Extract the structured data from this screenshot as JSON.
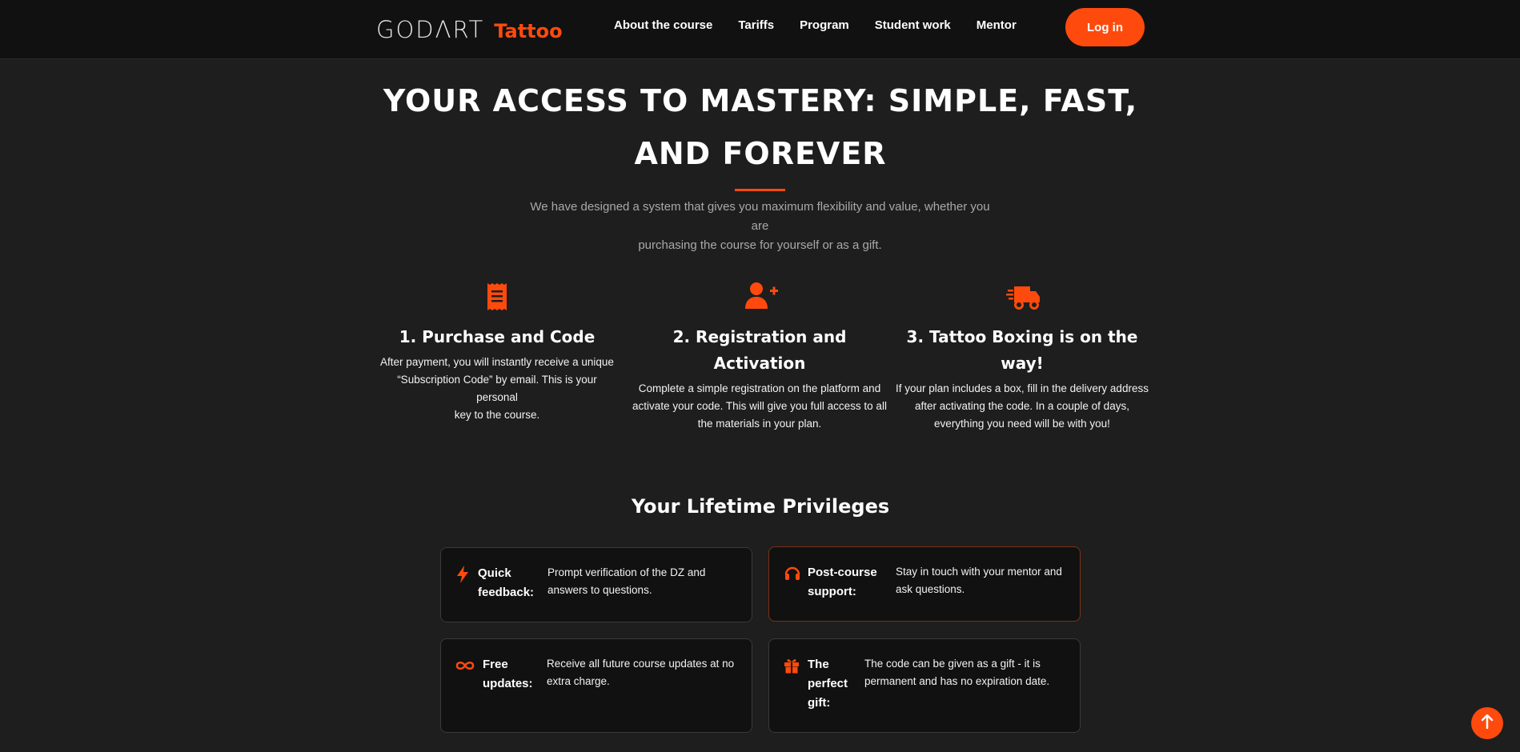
{
  "header": {
    "logo_main": "GODΛRT",
    "logo_sub": "Tattoo",
    "nav": [
      "About the course",
      "Tariffs",
      "Program",
      "Student work",
      "Mentor"
    ],
    "login": "Log in"
  },
  "hero": {
    "title_line1": "YOUR ACCESS TO MASTERY: SIMPLE, FAST,",
    "title_line2": "AND FOREVER",
    "subtitle_line1": "We have designed a system that gives you maximum flexibility and value, whether you are",
    "subtitle_line2": "purchasing the course for yourself or as a gift."
  },
  "steps": [
    {
      "icon": "receipt-icon",
      "title": "1. Purchase and Code",
      "text": [
        "After payment, you will instantly receive a unique",
        "“Subscription Code” by email. This is your personal",
        "key to the course."
      ]
    },
    {
      "icon": "user-plus-icon",
      "title": "2. Registration and Activation",
      "text": [
        "Complete a simple registration on the platform and",
        "activate your code. This will give you full access to all",
        "the materials in your plan."
      ]
    },
    {
      "icon": "truck-icon",
      "title_line1": "3. Tattoo Boxing is on the",
      "title_line2": "way!",
      "text": [
        "If your plan includes a box, fill in the delivery address",
        "after activating the code. In a couple of days,",
        "everything you need will be with you!"
      ]
    }
  ],
  "privileges": {
    "title": "Your Lifetime Privileges",
    "items": [
      {
        "icon": "lightning-icon",
        "title": [
          "Quick",
          "feedback:"
        ],
        "text": [
          "Prompt verification of the DZ and",
          "answers to questions."
        ]
      },
      {
        "icon": "headset-icon",
        "title": [
          "Post-course",
          "support:"
        ],
        "text": [
          "Stay in touch with your mentor and",
          "ask questions."
        ]
      },
      {
        "icon": "infinity-icon",
        "title": [
          "Free",
          "updates:"
        ],
        "text": [
          "Receive all future course updates at no",
          "extra charge."
        ]
      },
      {
        "icon": "gift-icon",
        "title": [
          "The",
          "perfect",
          "gift:"
        ],
        "text": [
          "The code can be given as a gift - it is",
          "permanent and has no expiration date."
        ]
      }
    ]
  },
  "colors": {
    "accent": "#ff4a0d",
    "background": "#1e1e1e",
    "card": "#111111"
  },
  "scroll_top_icon": "arrow-up-icon"
}
